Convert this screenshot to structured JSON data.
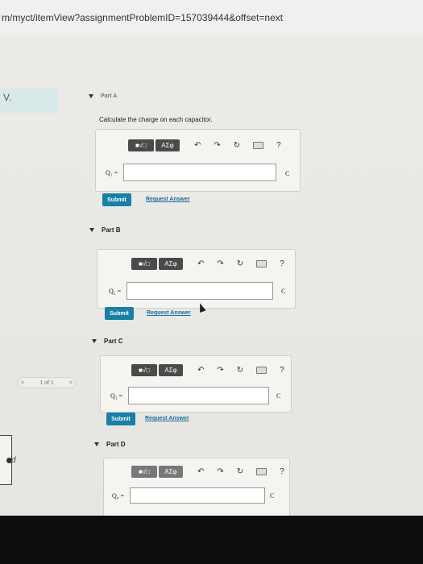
{
  "browser": {
    "url": "m/myct/itemView?assignmentProblemID=157039444&offset=next"
  },
  "sidebar": {
    "tab_label": "V.",
    "pager_text": "1 of 1",
    "pager_prev": "<",
    "pager_next": ">",
    "bottom_letter": "d"
  },
  "part_a": {
    "title": "Part A",
    "question": "Calculate the charge on each capacitor.",
    "label": "Q₁ =",
    "unit": "C",
    "submit": "Submit",
    "request": "Request Answer"
  },
  "parts": [
    {
      "title": "Part B",
      "label": "Q₂ =",
      "unit": "C",
      "submit": "Submit",
      "request": "Request Answer"
    },
    {
      "title": "Part C",
      "label": "Q₃ =",
      "unit": "C",
      "submit": "Submit",
      "request": "Request Answer"
    },
    {
      "title": "Part D",
      "label": "Q₄ =",
      "unit": "C"
    }
  ],
  "toolbar": {
    "matrix_label": "■√□",
    "greek_label": "ΑΣφ",
    "undo_icon": "↶",
    "redo_icon": "↷",
    "reset_icon": "↻",
    "help_icon": "?"
  }
}
